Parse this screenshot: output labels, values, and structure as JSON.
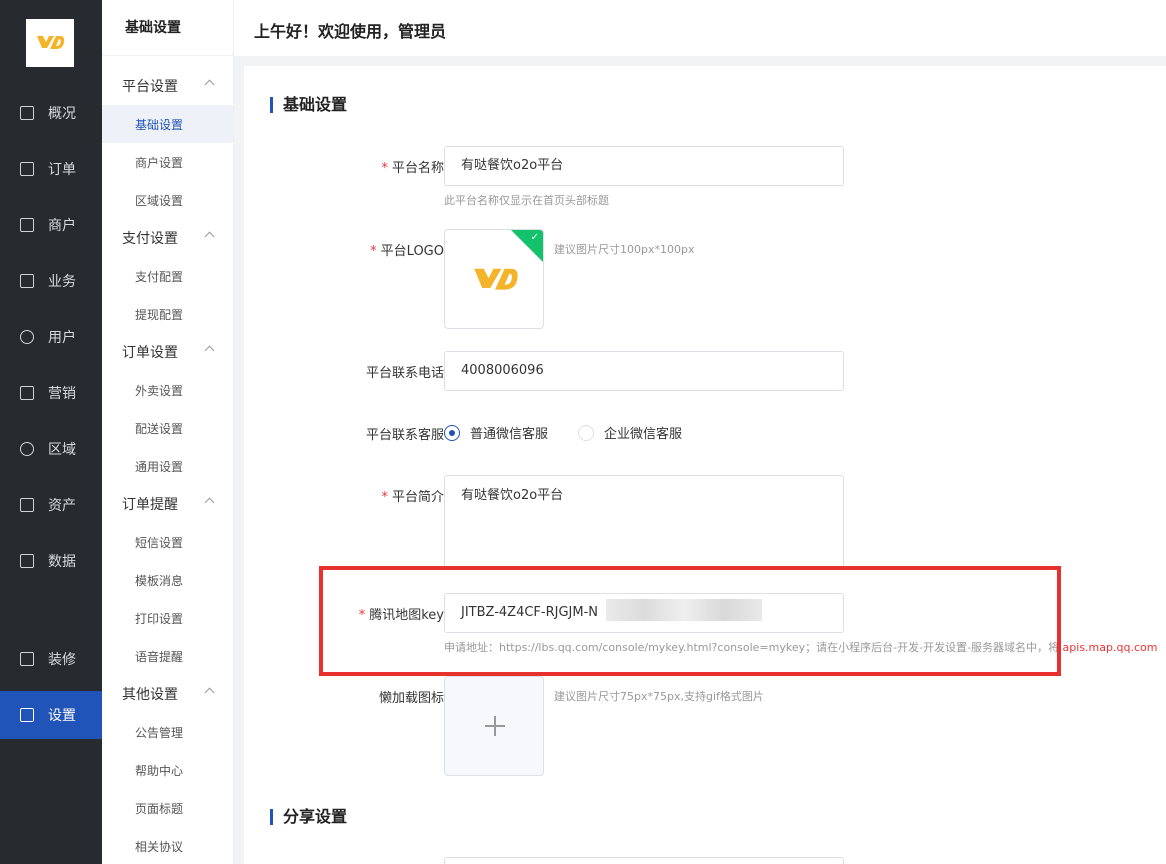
{
  "nav": {
    "items": [
      {
        "label": "概况",
        "icon": "chart-board-icon"
      },
      {
        "label": "订单",
        "icon": "order-list-icon"
      },
      {
        "label": "商户",
        "icon": "merchant-icon"
      },
      {
        "label": "业务",
        "icon": "business-icon"
      },
      {
        "label": "用户",
        "icon": "user-icon"
      },
      {
        "label": "营销",
        "icon": "marketing-icon"
      },
      {
        "label": "区域",
        "icon": "region-icon"
      },
      {
        "label": "资产",
        "icon": "asset-icon"
      },
      {
        "label": "数据",
        "icon": "bar-chart-icon"
      },
      {
        "label": "装修",
        "icon": "decorate-icon"
      },
      {
        "label": "设置",
        "icon": "settings-icon"
      }
    ]
  },
  "submenu": {
    "header": "基础设置",
    "groups": [
      {
        "label": "平台设置",
        "items": [
          "基础设置",
          "商户设置",
          "区域设置"
        ]
      },
      {
        "label": "支付设置",
        "items": [
          "支付配置",
          "提现配置"
        ]
      },
      {
        "label": "订单设置",
        "items": [
          "外卖设置",
          "配送设置",
          "通用设置"
        ]
      },
      {
        "label": "订单提醒",
        "items": [
          "短信设置",
          "模板消息",
          "打印设置",
          "语音提醒"
        ]
      },
      {
        "label": "其他设置",
        "items": [
          "公告管理",
          "帮助中心",
          "页面标题",
          "相关协议"
        ]
      }
    ]
  },
  "topbar": {
    "greeting": "上午好！欢迎使用，管理员"
  },
  "form": {
    "section_basic": "基础设置",
    "section_share": "分享设置",
    "platform_name": {
      "label": "平台名称",
      "value": "有哒餐饮o2o平台",
      "hint": "此平台名称仅显示在首页头部标题"
    },
    "platform_logo": {
      "label": "平台LOGO",
      "hint": "建议图片尺寸100px*100px"
    },
    "phone": {
      "label": "平台联系电话",
      "value": "4008006096"
    },
    "service": {
      "label": "平台联系客服",
      "options": [
        "普通微信客服",
        "企业微信客服"
      ],
      "selected": "普通微信客服"
    },
    "intro": {
      "label": "平台简介",
      "value": "有哒餐饮o2o平台"
    },
    "map_key": {
      "label": "腾讯地图key",
      "value": "JITBZ-4Z4CF-RJGJM-N",
      "hint_prefix": "申请地址：https://lbs.qq.com/console/mykey.html?console=mykey；请在小程序后台-开发-开发设置-服务器域名中，将",
      "hint_red": "apis.map.qq.com"
    },
    "lazy_icon": {
      "label": "懒加载图标",
      "hint": "建议图片尺寸75px*75px,支持gif格式图片"
    }
  },
  "colors": {
    "accent": "#2154b8",
    "nav_bg": "#272b30",
    "highlight": "#e8302e",
    "logo_yellow": "#f4b42a"
  }
}
